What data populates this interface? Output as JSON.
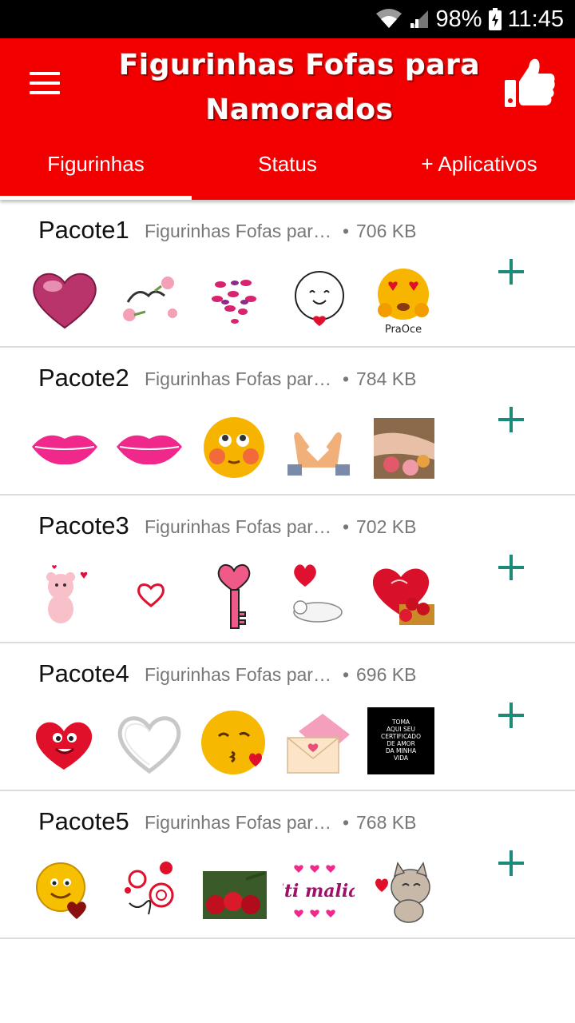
{
  "status_bar": {
    "battery": "98%",
    "time": "11:45"
  },
  "app_bar": {
    "title_line1": "Figurinhas Fofas para",
    "title_line2": "Namorados"
  },
  "tabs": [
    {
      "label": "Figurinhas",
      "selected": true
    },
    {
      "label": "Status",
      "selected": false
    },
    {
      "label": "+ Aplicativos",
      "selected": false
    }
  ],
  "colors": {
    "primary": "#f20000",
    "accent": "#1a8a7a"
  },
  "packs": [
    {
      "name": "Pacote1",
      "publisher": "Figurinhas Fofas para Namorados",
      "dot": "•",
      "size": "706 KB",
      "stickers": [
        "glossy-heart",
        "love-roses",
        "kisses-heart",
        "happy-face-heart",
        "heart-eyes-emoji"
      ],
      "caption": "PraOce"
    },
    {
      "name": "Pacote2",
      "publisher": "Figurinhas Fofas para Namorados",
      "dot": "•",
      "size": "784 KB",
      "stickers": [
        "pink-lips",
        "pink-lips",
        "blushing-emoji",
        "hands-heart",
        "nails-roses"
      ]
    },
    {
      "name": "Pacote3",
      "publisher": "Figurinhas Fofas para Namorados",
      "dot": "•",
      "size": "702 KB",
      "stickers": [
        "pink-teddy",
        "small-heart",
        "heart-key",
        "heart-cat",
        "eu-te-amo-heart"
      ]
    },
    {
      "name": "Pacote4",
      "publisher": "Figurinhas Fofas para Namorados",
      "dot": "•",
      "size": "696 KB",
      "stickers": [
        "red-heart-character",
        "silver-heart",
        "kissing-emoji",
        "love-envelope",
        "certificate"
      ],
      "certificate_text": [
        "TOMA",
        "AQUI SEU",
        "CERTIFICADO",
        "DE AMOR",
        "DA MINHA",
        "VIDA"
      ]
    },
    {
      "name": "Pacote5",
      "publisher": "Figurinhas Fofas para Namorados",
      "dot": "•",
      "size": "768 KB",
      "stickers": [
        "smiley-heart",
        "red-swirls",
        "red-roses",
        "iti-malia",
        "cat-heart"
      ],
      "sticker_text": "iti malia"
    }
  ]
}
